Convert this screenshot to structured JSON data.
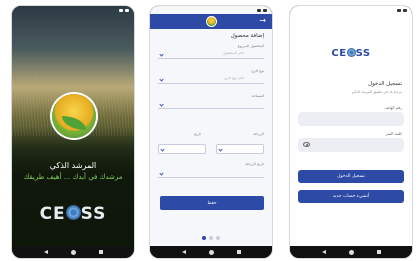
{
  "phone1": {
    "time": "",
    "app_title": "المرشد الذكي",
    "tagline": "مرشدك في أيدك ... أهيف طريقك",
    "brand": {
      "pre": "CE",
      "post": "SS"
    }
  },
  "phone2": {
    "form_title": "إضافة محصول",
    "fields": [
      {
        "label": "المحصول المزروع",
        "value": "اختر المحصول"
      },
      {
        "label": "نوع الري",
        "value": "اختر نوع الري"
      },
      {
        "label": "المساحة",
        "value": ""
      }
    ],
    "row_label_right": "الزراعة",
    "row_label_left": "تاريخ",
    "field_date_label": "تاريخ الزراعة",
    "submit_label": "حفظ",
    "pager_count": 3
  },
  "phone3": {
    "brand": {
      "pre": "CE",
      "post": "SS"
    },
    "title": "تسجيل الدخول",
    "subtitle": "مرحبا بك في تطبيق المرشد الذكي",
    "username_label": "رقم الهاتف",
    "password_label": "كلمة السر",
    "login_button": "تسجيل الدخول",
    "register_button": "أنشيء حساب جديد"
  },
  "colors": {
    "primary": "#2c4aa6",
    "accent_green": "#7fd05a"
  }
}
